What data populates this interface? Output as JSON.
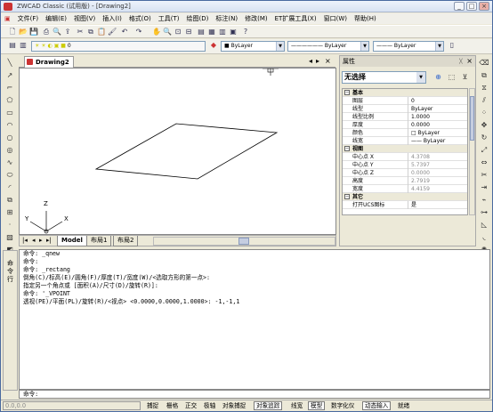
{
  "window": {
    "title": "ZWCAD Classic (试用版) - [Drawing2]",
    "min": "_",
    "max": "□",
    "close": "×"
  },
  "menu": [
    "文件(F)",
    "编辑(E)",
    "视图(V)",
    "插入(I)",
    "格式(O)",
    "工具(T)",
    "绘图(D)",
    "标注(N)",
    "修改(M)",
    "ET扩展工具(X)",
    "窗口(W)",
    "帮助(H)"
  ],
  "toolbar": {
    "layer_value": "0",
    "color_value": "■ ByLayer",
    "linetype_value": "ByLayer",
    "lineweight_value": "ByLayer"
  },
  "drawing": {
    "tab": "Drawing2",
    "layout_tabs": [
      "Model",
      "布局1",
      "布局2"
    ],
    "ucs": {
      "x": "X",
      "y": "Y",
      "z": "Z"
    }
  },
  "properties": {
    "title": "属性",
    "close": "×",
    "pin": "ᚷ",
    "selection": "无选择",
    "sections": [
      {
        "name": "基本",
        "rows": [
          [
            "图层",
            "0"
          ],
          [
            "线型",
            "ByLayer"
          ],
          [
            "线型比例",
            "1.0000"
          ],
          [
            "厚度",
            "0.0000"
          ],
          [
            "颜色",
            "□ ByLayer"
          ],
          [
            "线宽",
            "—— ByLayer"
          ]
        ]
      },
      {
        "name": "视图",
        "rows": [
          [
            "中心点 X",
            "4.3708"
          ],
          [
            "中心点 Y",
            "5.7397"
          ],
          [
            "中心点 Z",
            "0.0000"
          ],
          [
            "高度",
            "2.7919"
          ],
          [
            "宽度",
            "4.4159"
          ]
        ]
      },
      {
        "name": "其它",
        "rows": [
          [
            "打开UCS图标",
            "是"
          ]
        ]
      }
    ]
  },
  "command": {
    "side_label": "命令行",
    "lines": [
      "命令: _qnew",
      "命令:",
      "命令: _rectang",
      "倒角(C)/标高(E)/圆角(F)/厚度(T)/宽度(W)/<选取方形的第一点>:",
      "指定另一个角点或 [面积(A)/尺寸(D)/旋转(R)]:",
      "命令: '_VPOINT",
      "透视(PE)/平面(PL)/旋转(R)/<视点> <0.0000,0.0000,1.0000>: -1,-1,1"
    ],
    "prompt": "命令:"
  },
  "status": {
    "coords": "0.0,0.0",
    "buttons": [
      {
        "label": "捕捉",
        "on": false
      },
      {
        "label": "栅格",
        "on": false
      },
      {
        "label": "正交",
        "on": false
      },
      {
        "label": "极轴",
        "on": false
      },
      {
        "label": "对象捕捉",
        "on": false
      },
      {
        "label": "对象追踪",
        "on": true
      },
      {
        "label": "线宽",
        "on": false
      },
      {
        "label": "模型",
        "on": true
      },
      {
        "label": "数字化仪",
        "on": false
      },
      {
        "label": "动态输入",
        "on": true
      },
      {
        "label": "就绪",
        "on": false
      }
    ]
  }
}
